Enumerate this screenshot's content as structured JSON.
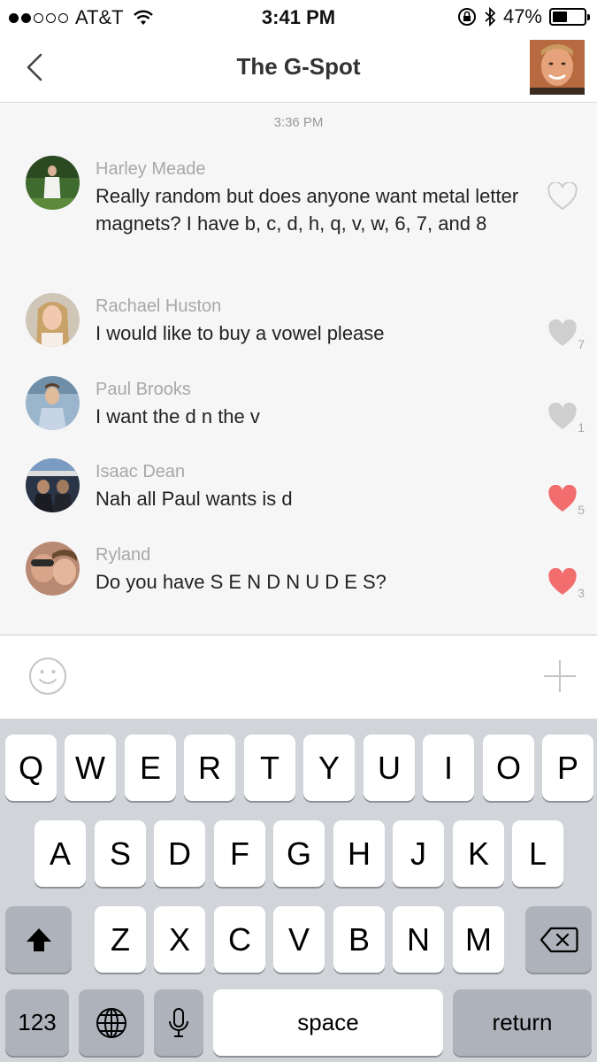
{
  "status_bar": {
    "carrier": "AT&T",
    "time": "3:41 PM",
    "battery_percent": "47%",
    "battery_level": 0.47,
    "signal_bars_filled": 2,
    "signal_bars_total": 5
  },
  "nav": {
    "title": "The G-Spot"
  },
  "chat": {
    "timestamp": "3:36 PM",
    "messages": [
      {
        "sender": "Harley Meade",
        "text": "Really random but does anyone want metal letter magnets? I have b, c, d, h, q, v, w, 6, 7, and 8",
        "likes": "",
        "liked": false
      },
      {
        "sender": "Rachael Huston",
        "text": "I would like to buy a vowel please",
        "likes": "7",
        "liked": false
      },
      {
        "sender": "Paul Brooks",
        "text": "I want the d n the v",
        "likes": "1",
        "liked": false
      },
      {
        "sender": "Isaac Dean",
        "text": "Nah all Paul wants is d",
        "likes": "5",
        "liked": true
      },
      {
        "sender": "Ryland",
        "text": "Do you have S E N D N U D E S?",
        "likes": "3",
        "liked": true
      }
    ]
  },
  "colors": {
    "heart_liked": "#f26d6d",
    "heart_unliked": "#cfcfcf",
    "heart_outline": "#c8c8c8"
  },
  "keyboard": {
    "row1": [
      "Q",
      "W",
      "E",
      "R",
      "T",
      "Y",
      "U",
      "I",
      "O",
      "P"
    ],
    "row2": [
      "A",
      "S",
      "D",
      "F",
      "G",
      "H",
      "J",
      "K",
      "L"
    ],
    "row3": [
      "Z",
      "X",
      "C",
      "V",
      "B",
      "N",
      "M"
    ],
    "numbers_label": "123",
    "space_label": "space",
    "return_label": "return",
    "icons": {
      "shift": "shift-icon",
      "delete": "delete-icon",
      "globe": "globe-icon",
      "mic": "microphone-icon"
    }
  }
}
